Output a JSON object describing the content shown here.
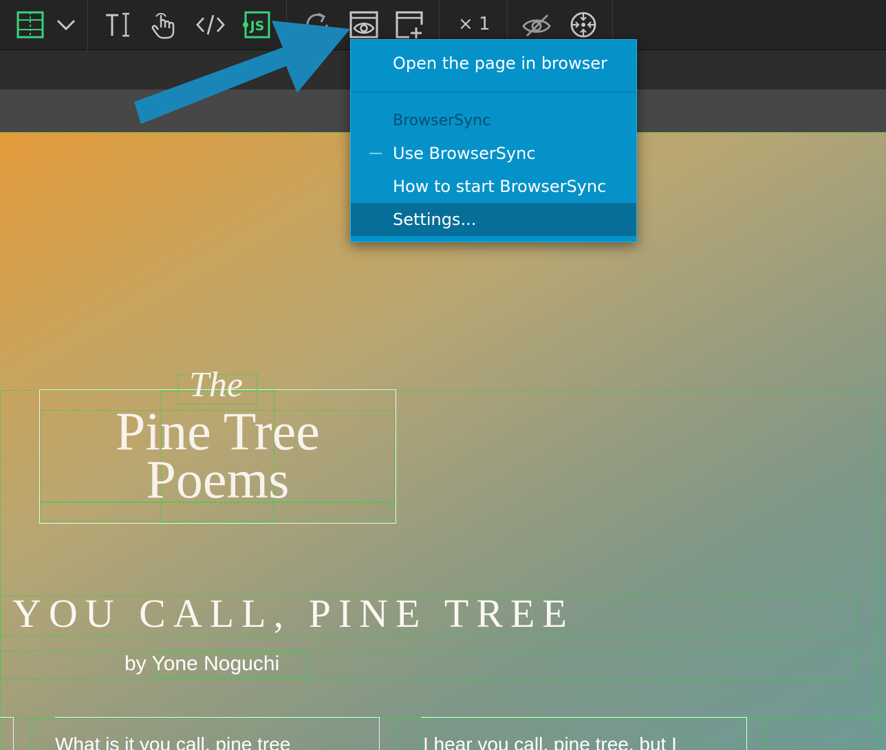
{
  "toolbar": {
    "buttons": [
      {
        "icon": "layout-grid-icon"
      },
      {
        "icon": "chevron-down-icon"
      },
      {
        "icon": "text-edit-icon"
      },
      {
        "icon": "touch-interaction-icon"
      },
      {
        "icon": "code-icon"
      },
      {
        "icon": "javascript-icon",
        "label": "JS"
      },
      {
        "icon": "refresh-icon"
      },
      {
        "icon": "preview-eye-icon"
      },
      {
        "icon": "new-window-icon"
      },
      {
        "icon": "visibility-off-icon"
      },
      {
        "icon": "target-icon"
      }
    ],
    "zoom_label": "× 1",
    "colors": {
      "background": "#242424",
      "active_icon": "#39d27a",
      "icon": "#c8c8c8"
    }
  },
  "menu": {
    "items": [
      {
        "label": "Open the page in browser",
        "type": "item"
      },
      {
        "label": "BrowserSync",
        "type": "header"
      },
      {
        "label": "Use BrowserSync",
        "type": "item",
        "state": "dash"
      },
      {
        "label": "How to start BrowserSync",
        "type": "item"
      },
      {
        "label": "Settings...",
        "type": "item",
        "highlighted": true
      }
    ],
    "colors": {
      "background": "#0592c9",
      "highlight": "#066e99",
      "header_text": "#0b4d6c"
    }
  },
  "page": {
    "title_the": "The",
    "title_line1": "Pine Tree",
    "title_line2": "Poems",
    "poem_title": "YOU CALL, PINE TREE",
    "byline_by": "by",
    "byline_author": "Yone Noguchi",
    "poem_line_left": "What is it you call, pine tree",
    "poem_line_right": "I hear you call, pine tree, but I"
  },
  "annotation": {
    "color": "#1a86b8"
  }
}
